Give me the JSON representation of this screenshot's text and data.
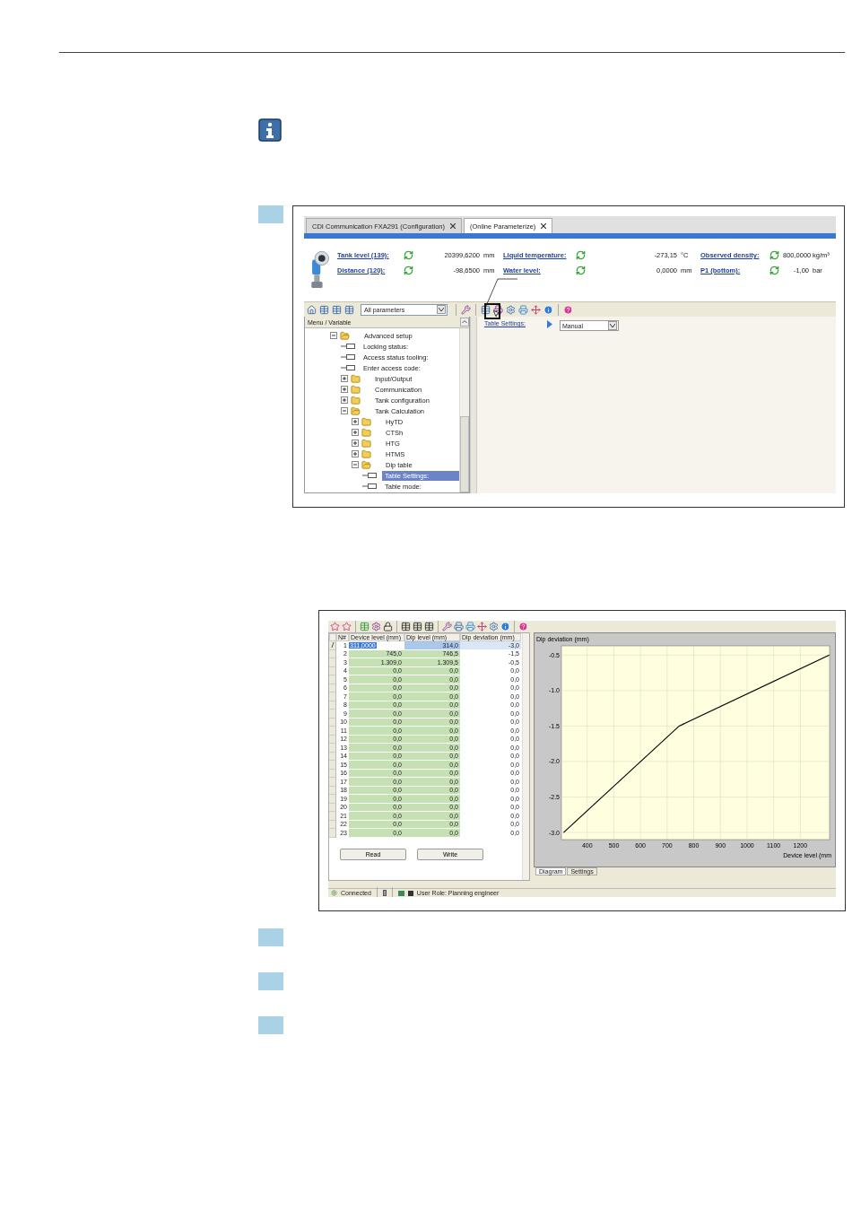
{
  "screenshot_1": {
    "tabs": [
      {
        "label": "CDI Communication FXA291  (Configuration)",
        "selected": false
      },
      {
        "label": "(Online Parameterize)",
        "selected": true
      }
    ],
    "header_values": [
      {
        "label": "Tank level (139):",
        "value": "20399,6200",
        "unit": "mm"
      },
      {
        "label": "Liquid temperature:",
        "value": "-273,15",
        "unit": "°C"
      },
      {
        "label": "Observed density:",
        "value": "800,0000",
        "unit": "kg/m³"
      },
      {
        "label": "Distance (120):",
        "value": "-98,6500",
        "unit": "mm"
      },
      {
        "label": "Water level:",
        "value": "0,0000",
        "unit": "mm"
      },
      {
        "label": "P1 (bottom):",
        "value": "-1,00",
        "unit": "bar"
      }
    ],
    "filter": {
      "value": "All parameters"
    },
    "tree": {
      "header": "Menu / Variable",
      "items": [
        {
          "label": "Advanced setup",
          "kind": "folder",
          "expanded": true,
          "selected": false,
          "children": [
            {
              "label": "Locking status:",
              "kind": "param",
              "selected": false
            },
            {
              "label": "Access status tooling:",
              "kind": "param",
              "selected": false
            },
            {
              "label": "Enter access code:",
              "kind": "param",
              "selected": false
            },
            {
              "label": "Input/Output",
              "kind": "folder",
              "expanded": false,
              "selected": false
            },
            {
              "label": "Communication",
              "kind": "folder",
              "expanded": false,
              "selected": false
            },
            {
              "label": "Tank configuration",
              "kind": "folder",
              "expanded": false,
              "selected": false
            },
            {
              "label": "Tank Calculation",
              "kind": "folder",
              "expanded": true,
              "selected": false,
              "children": [
                {
                  "label": "HyTD",
                  "kind": "folder",
                  "expanded": false,
                  "selected": false
                },
                {
                  "label": "CTSh",
                  "kind": "folder",
                  "expanded": false,
                  "selected": false
                },
                {
                  "label": "HTG",
                  "kind": "folder",
                  "expanded": false,
                  "selected": false
                },
                {
                  "label": "HTMS",
                  "kind": "folder",
                  "expanded": false,
                  "selected": false
                },
                {
                  "label": "Dip table",
                  "kind": "folder",
                  "expanded": true,
                  "selected": false,
                  "children": [
                    {
                      "label": "Table Settings:",
                      "kind": "param",
                      "selected": true
                    },
                    {
                      "label": "Table mode:",
                      "kind": "param",
                      "selected": false
                    }
                  ]
                }
              ]
            }
          ]
        }
      ]
    },
    "parameter": {
      "label": "Table Settings:",
      "value": "Manual"
    }
  },
  "screenshot_2": {
    "table": {
      "columns": [
        "N#",
        "Device level (mm)",
        "Dip level (mm)",
        "Dip deviation (mm)"
      ],
      "rows": [
        {
          "n": "1",
          "device": "311,0000",
          "dip": "314,0",
          "deviation": "-3,0",
          "selected": true
        },
        {
          "n": "2",
          "device": "745,0",
          "dip": "746,5",
          "deviation": "-1,5",
          "selected": false
        },
        {
          "n": "3",
          "device": "1.309,0",
          "dip": "1.309,5",
          "deviation": "-0,5",
          "selected": false
        },
        {
          "n": "4",
          "device": "0,0",
          "dip": "0,0",
          "deviation": "0,0",
          "selected": false
        },
        {
          "n": "5",
          "device": "0,0",
          "dip": "0,0",
          "deviation": "0,0",
          "selected": false
        },
        {
          "n": "6",
          "device": "0,0",
          "dip": "0,0",
          "deviation": "0,0",
          "selected": false
        },
        {
          "n": "7",
          "device": "0,0",
          "dip": "0,0",
          "deviation": "0,0",
          "selected": false
        },
        {
          "n": "8",
          "device": "0,0",
          "dip": "0,0",
          "deviation": "0,0",
          "selected": false
        },
        {
          "n": "9",
          "device": "0,0",
          "dip": "0,0",
          "deviation": "0,0",
          "selected": false
        },
        {
          "n": "10",
          "device": "0,0",
          "dip": "0,0",
          "deviation": "0,0",
          "selected": false
        },
        {
          "n": "11",
          "device": "0,0",
          "dip": "0,0",
          "deviation": "0,0",
          "selected": false
        },
        {
          "n": "12",
          "device": "0,0",
          "dip": "0,0",
          "deviation": "0,0",
          "selected": false
        },
        {
          "n": "13",
          "device": "0,0",
          "dip": "0,0",
          "deviation": "0,0",
          "selected": false
        },
        {
          "n": "14",
          "device": "0,0",
          "dip": "0,0",
          "deviation": "0,0",
          "selected": false
        },
        {
          "n": "15",
          "device": "0,0",
          "dip": "0,0",
          "deviation": "0,0",
          "selected": false
        },
        {
          "n": "16",
          "device": "0,0",
          "dip": "0,0",
          "deviation": "0,0",
          "selected": false
        },
        {
          "n": "17",
          "device": "0,0",
          "dip": "0,0",
          "deviation": "0,0",
          "selected": false
        },
        {
          "n": "18",
          "device": "0,0",
          "dip": "0,0",
          "deviation": "0,0",
          "selected": false
        },
        {
          "n": "19",
          "device": "0,0",
          "dip": "0,0",
          "deviation": "0,0",
          "selected": false
        },
        {
          "n": "20",
          "device": "0,0",
          "dip": "0,0",
          "deviation": "0,0",
          "selected": false
        },
        {
          "n": "21",
          "device": "0,0",
          "dip": "0,0",
          "deviation": "0,0",
          "selected": false
        },
        {
          "n": "22",
          "device": "0,0",
          "dip": "0,0",
          "deviation": "0,0",
          "selected": false
        },
        {
          "n": "23",
          "device": "0,0",
          "dip": "0,0",
          "deviation": "0,0",
          "selected": false
        }
      ]
    },
    "buttons": [
      "Read",
      "Write"
    ],
    "chart_data": {
      "type": "line",
      "title": "Dip deviation (mm)",
      "xlabel": "Device level (mm",
      "x": [
        311,
        745,
        1309
      ],
      "values": [
        -3.0,
        -1.5,
        -0.5
      ],
      "xlim": [
        303,
        1310
      ],
      "ylim": [
        -3.1,
        -0.37
      ],
      "xticks": [
        400,
        500,
        600,
        700,
        800,
        900,
        1000,
        1100,
        1200
      ],
      "yticks": [
        {
          "value": -0.5,
          "label": "-0.5"
        },
        {
          "value": -1.0,
          "label": "-1.0"
        },
        {
          "value": -1.5,
          "label": "-1.5"
        },
        {
          "value": -2.0,
          "label": "-2.0"
        },
        {
          "value": -2.5,
          "label": "-2.5"
        },
        {
          "value": -3.0,
          "label": "-3.0"
        }
      ],
      "grid": true
    },
    "chart_tabs": [
      {
        "label": "Diagram",
        "selected": true
      },
      {
        "label": "Settings",
        "selected": false
      }
    ],
    "status_bar": {
      "connection": "Connected",
      "user_role": "User Role: Planning engineer"
    }
  }
}
